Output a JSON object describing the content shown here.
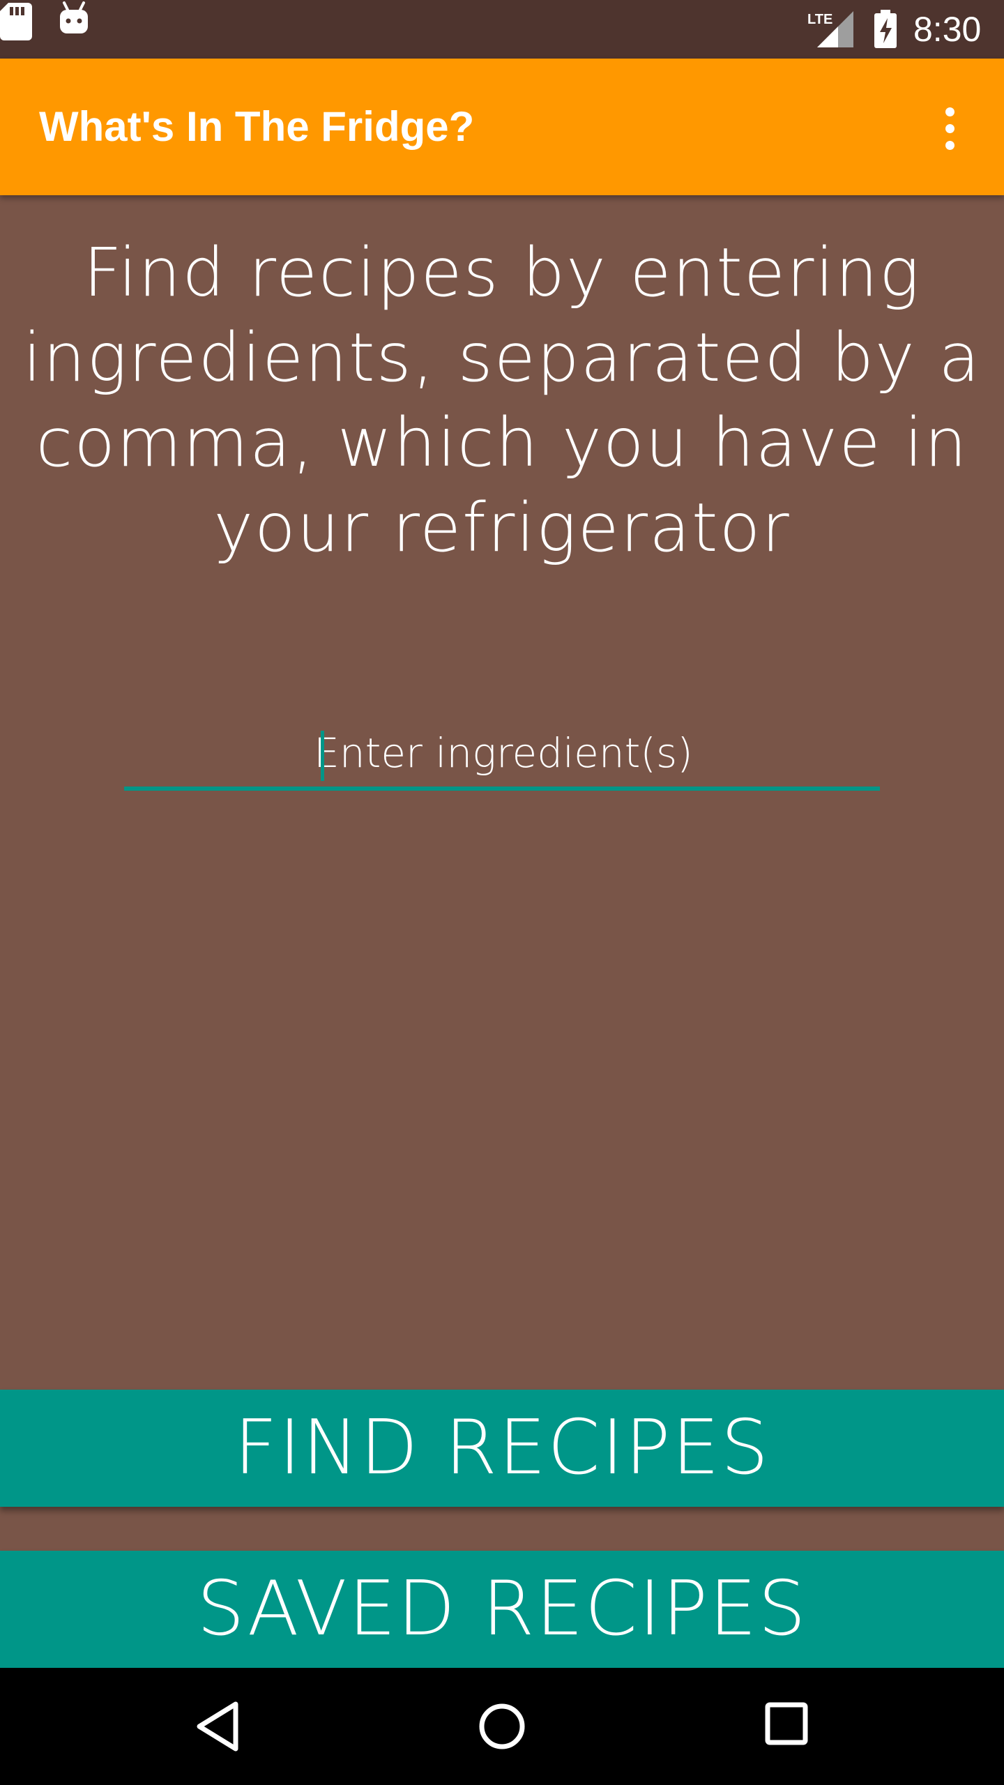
{
  "status_bar": {
    "time": "8:30",
    "icons": [
      "sd-card-icon",
      "android-icon",
      "lte-signal-icon",
      "battery-charging-icon"
    ],
    "network_label": "LTE"
  },
  "app_bar": {
    "title": "What's In The Fridge?",
    "menu_icon": "more-vert-icon"
  },
  "main": {
    "instructions": "Find recipes by entering ingredients, separated by a comma, which you have in your refrigerator",
    "ingredient_input": {
      "value": "",
      "placeholder": "Enter ingredient(s)"
    },
    "find_button_label": "FIND RECIPES",
    "saved_button_label": "SAVED RECIPES"
  },
  "nav_bar": {
    "icons": [
      "back-icon",
      "home-icon",
      "recents-icon"
    ]
  },
  "colors": {
    "status_bar": "#4e342e",
    "app_bar": "#ff9800",
    "background": "#795548",
    "accent": "#009688",
    "nav_bar": "#000000"
  }
}
